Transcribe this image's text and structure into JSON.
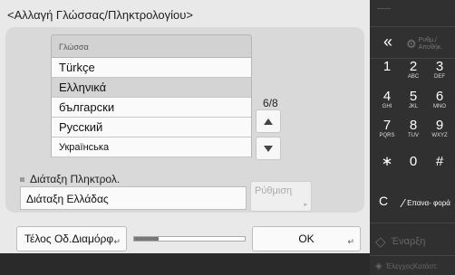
{
  "dialog": {
    "title": "<Αλλαγή Γλώσσας/Πληκτρολογίου>",
    "language_header": "Γλώσσα",
    "languages": [
      "Türkçe",
      "Ελληνικά",
      "български",
      "Русский",
      "Українська"
    ],
    "selected_language": "Ελληνικά",
    "page_indicator": "6/8",
    "keyboard_label": "Διάταξη Πληκτρολ.",
    "keyboard_value": "Διάταξη Ελλάδας",
    "settings_button": "Ρύθμιση",
    "end_button": "Τέλος Οδ.Διαμόρφ",
    "ok_button": "OK",
    "progress": 0.22
  },
  "panel": {
    "back_symbol": "«",
    "settings_registration": "Ρυθμ./ Αποθήκ.",
    "keys": [
      {
        "n": "1",
        "l": ""
      },
      {
        "n": "2",
        "l": "ABC"
      },
      {
        "n": "3",
        "l": "DEF"
      },
      {
        "n": "4",
        "l": "GHI"
      },
      {
        "n": "5",
        "l": "JKL"
      },
      {
        "n": "6",
        "l": "MNO"
      },
      {
        "n": "7",
        "l": "PQRS"
      },
      {
        "n": "8",
        "l": "TUV"
      },
      {
        "n": "9",
        "l": "WXYZ"
      },
      {
        "n": "∗",
        "l": ""
      },
      {
        "n": "0",
        "l": ""
      },
      {
        "n": "#",
        "l": ""
      }
    ],
    "clear_key": "C",
    "reset_label": "Επανα- φορά",
    "start_label": "Έναρξη",
    "stop_label": "ΈλεγχοςΚατάστ."
  }
}
